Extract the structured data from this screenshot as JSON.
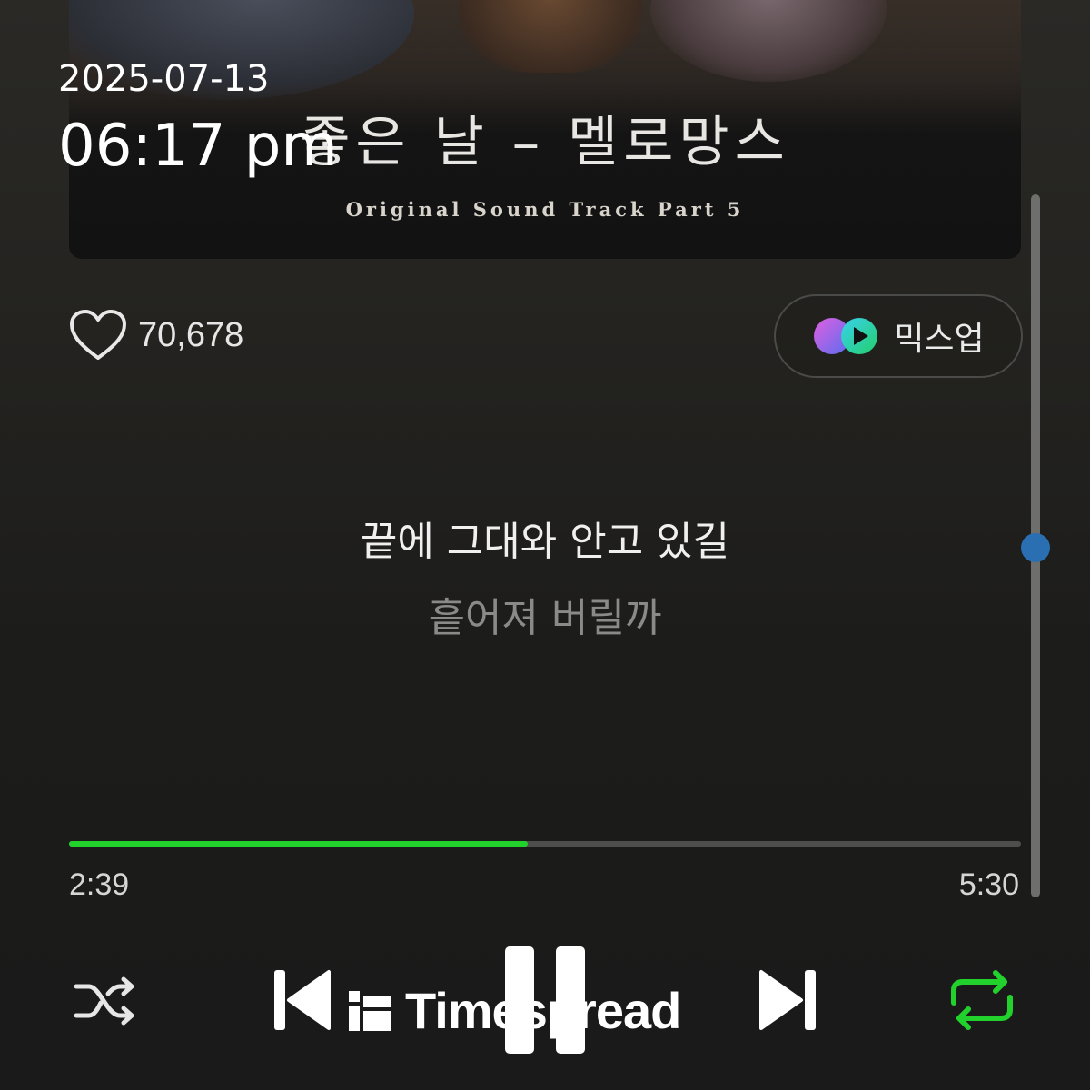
{
  "album_art": {
    "title": "좋은 날 – 멜로망스",
    "subtitle": "Original Sound Track Part 5"
  },
  "overlay": {
    "date": "2025-07-13",
    "time": "06:17 pm"
  },
  "like": {
    "icon": "heart-icon",
    "count": "70,678"
  },
  "mixup": {
    "icon": "mixup-icon",
    "label": "믹스업"
  },
  "lyrics": {
    "current": "끝에 그대와 안고 있길",
    "next": "흩어져 버릴까"
  },
  "playback": {
    "elapsed": "2:39",
    "total": "5:30",
    "progress_fraction": 0.482
  },
  "controls": {
    "shuffle_icon": "shuffle-icon",
    "previous_icon": "previous-icon",
    "pause_icon": "pause-icon",
    "next_icon": "next-icon",
    "repeat_icon": "repeat-icon"
  },
  "watermark": {
    "text": "Timespread"
  },
  "colors": {
    "accent_green": "#23d12d",
    "scroll_thumb": "#2a6fb2"
  }
}
